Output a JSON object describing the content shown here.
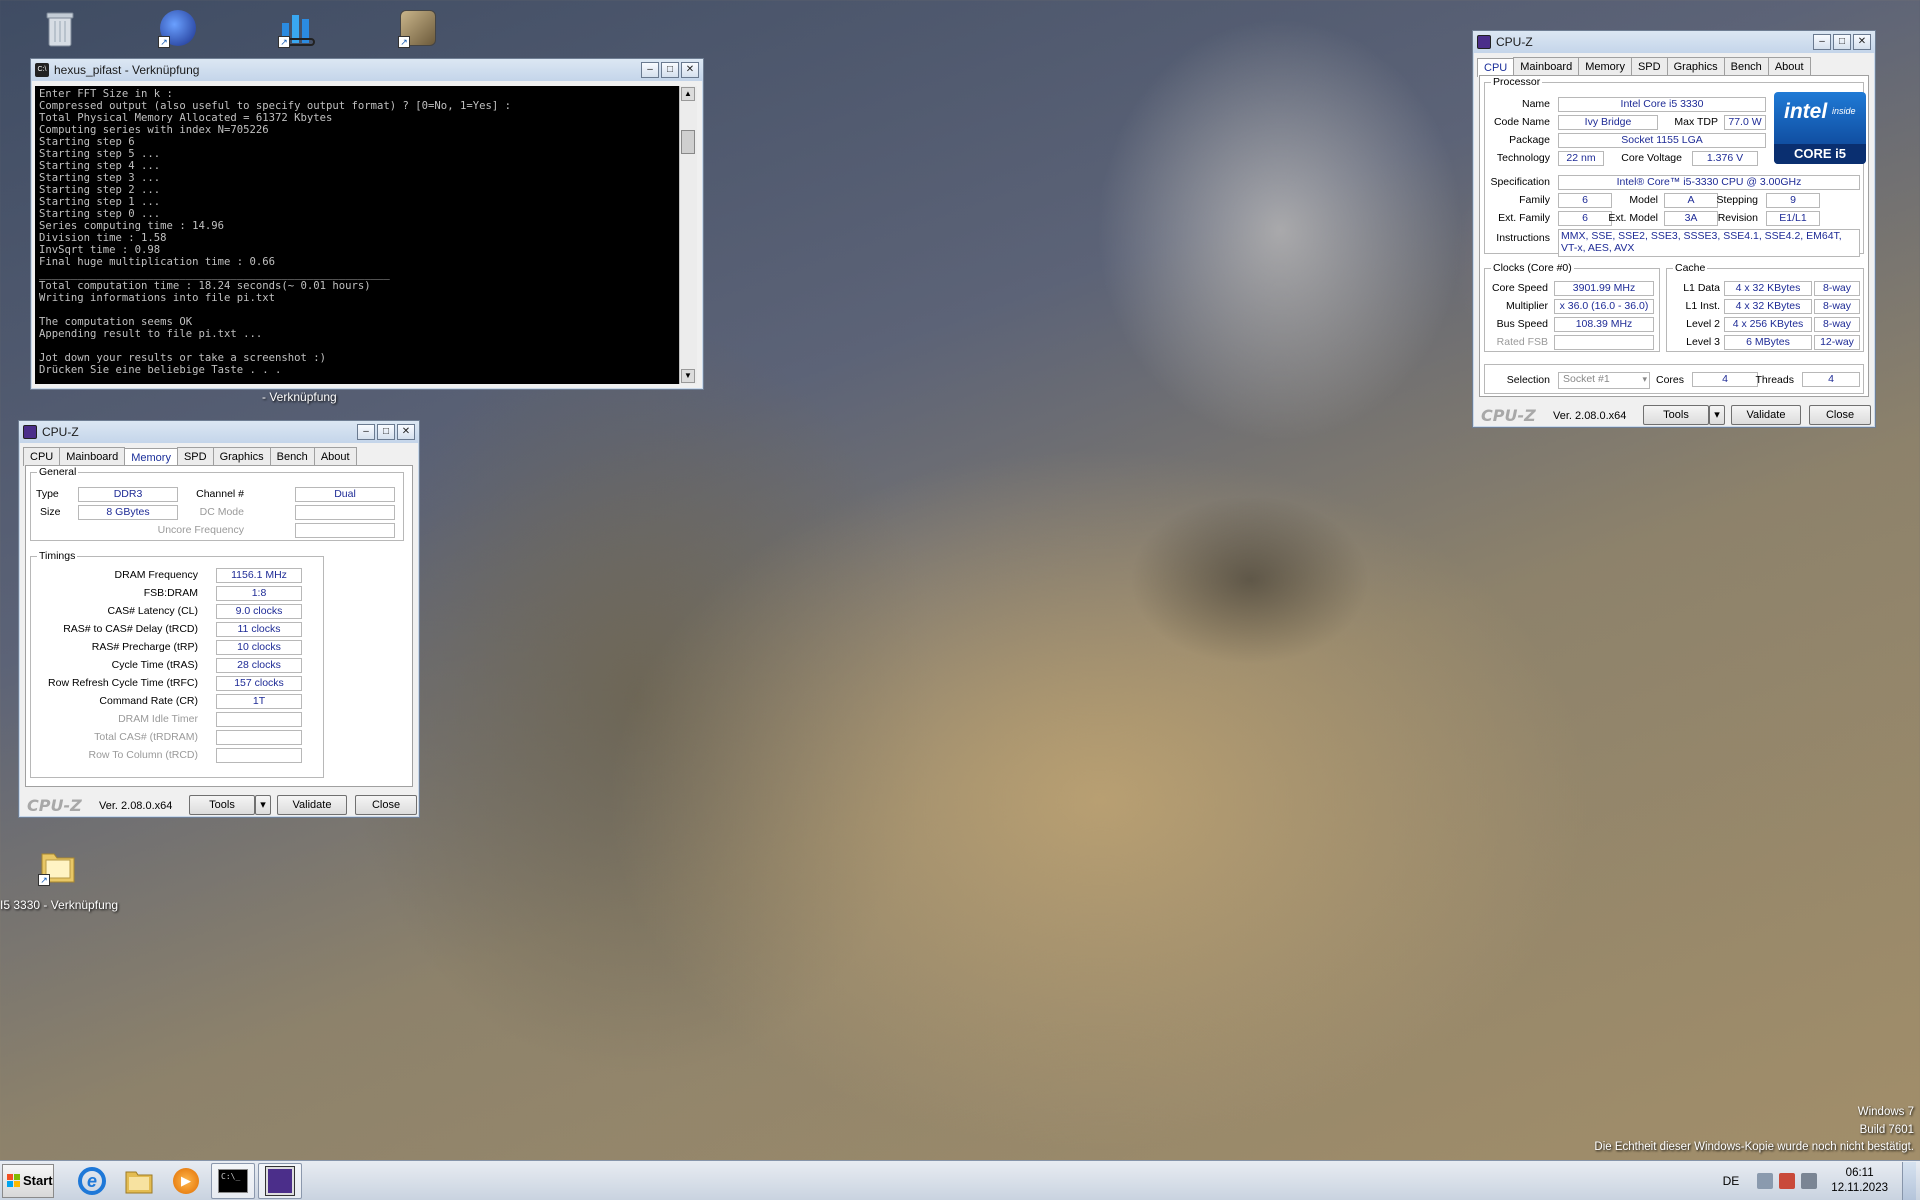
{
  "desktop": {
    "shortcut_label": "I5 3330 - Verknüpfung",
    "partial_label": "- Verknüpfung"
  },
  "console": {
    "title": "hexus_pifast - Verknüpfung",
    "lines": [
      "Enter FFT Size in k :",
      "Compressed output (also useful to specify output format) ? [0=No, 1=Yes] :",
      "Total Physical Memory Allocated = 61372 Kbytes",
      "Computing series with index N=705226",
      "Starting step 6",
      "Starting step 5 ...",
      "Starting step 4 ...",
      "Starting step 3 ...",
      "Starting step 2 ...",
      "Starting step 1 ...",
      "Starting step 0 ...",
      "Series computing time : 14.96",
      "Division time : 1.58",
      "InvSqrt time : 0.98",
      "Final huge multiplication time : 0.66",
      "_______________________________________________________",
      "Total computation time : 18.24 seconds(~ 0.01 hours)",
      "Writing informations into file pi.txt",
      "",
      "The computation seems OK",
      "Appending result to file pi.txt ...",
      "",
      "Jot down your results or take a screenshot :)",
      "Drücken Sie eine beliebige Taste . . ."
    ]
  },
  "common": {
    "app_title": "CPU-Z",
    "tabs": [
      "CPU",
      "Mainboard",
      "Memory",
      "SPD",
      "Graphics",
      "Bench",
      "About"
    ],
    "logo": "CPU-Z",
    "version": "Ver. 2.08.0.x64",
    "tools": "Tools",
    "validate": "Validate",
    "close": "Close"
  },
  "cpu": {
    "processor_legend": "Processor",
    "name_label": "Name",
    "name": "Intel Core i5 3330",
    "codename_label": "Code Name",
    "codename": "Ivy Bridge",
    "maxtdp_label": "Max TDP",
    "maxtdp": "77.0 W",
    "package_label": "Package",
    "package": "Socket 1155 LGA",
    "technology_label": "Technology",
    "technology": "22 nm",
    "corevoltage_label": "Core Voltage",
    "corevoltage": "1.376 V",
    "spec_label": "Specification",
    "spec": "Intel® Core™ i5-3330 CPU @ 3.00GHz",
    "family_label": "Family",
    "family": "6",
    "model_label": "Model",
    "model": "A",
    "stepping_label": "Stepping",
    "stepping": "9",
    "extfamily_label": "Ext. Family",
    "extfamily": "6",
    "extmodel_label": "Ext. Model",
    "extmodel": "3A",
    "revision_label": "Revision",
    "revision": "E1/L1",
    "instructions_label": "Instructions",
    "instructions": "MMX, SSE, SSE2, SSE3, SSSE3, SSE4.1, SSE4.2, EM64T, VT-x, AES, AVX",
    "clocks_legend": "Clocks (Core #0)",
    "corespeed_label": "Core Speed",
    "corespeed": "3901.99 MHz",
    "multiplier_label": "Multiplier",
    "multiplier": "x 36.0 (16.0 - 36.0)",
    "busspeed_label": "Bus Speed",
    "busspeed": "108.39 MHz",
    "ratedfsb_label": "Rated FSB",
    "cache_legend": "Cache",
    "l1d_label": "L1 Data",
    "l1d": "4 x 32 KBytes",
    "l1d_way": "8-way",
    "l1i_label": "L1 Inst.",
    "l1i": "4 x 32 KBytes",
    "l1i_way": "8-way",
    "l2_label": "Level 2",
    "l2": "4 x 256 KBytes",
    "l2_way": "8-way",
    "l3_label": "Level 3",
    "l3": "6 MBytes",
    "l3_way": "12-way",
    "selection_label": "Selection",
    "selection": "Socket #1",
    "cores_label": "Cores",
    "cores": "4",
    "threads_label": "Threads",
    "threads": "4",
    "intel_top": "intel",
    "intel_inside": "inside",
    "intel_bottom": "CORE i5"
  },
  "memory": {
    "general_legend": "General",
    "type_label": "Type",
    "type": "DDR3",
    "size_label": "Size",
    "size": "8 GBytes",
    "channel_label": "Channel #",
    "channel": "Dual",
    "dcmode_label": "DC Mode",
    "uncore_label": "Uncore Frequency",
    "timings_legend": "Timings",
    "timings": [
      {
        "label": "DRAM Frequency",
        "value": "1156.1 MHz",
        "dim": false
      },
      {
        "label": "FSB:DRAM",
        "value": "1:8",
        "dim": false
      },
      {
        "label": "CAS# Latency (CL)",
        "value": "9.0 clocks",
        "dim": false
      },
      {
        "label": "RAS# to CAS# Delay (tRCD)",
        "value": "11 clocks",
        "dim": false
      },
      {
        "label": "RAS# Precharge (tRP)",
        "value": "10 clocks",
        "dim": false
      },
      {
        "label": "Cycle Time (tRAS)",
        "value": "28 clocks",
        "dim": false
      },
      {
        "label": "Row Refresh Cycle Time (tRFC)",
        "value": "157 clocks",
        "dim": false
      },
      {
        "label": "Command Rate (CR)",
        "value": "1T",
        "dim": false
      },
      {
        "label": "DRAM Idle Timer",
        "value": "",
        "dim": true
      },
      {
        "label": "Total CAS# (tRDRAM)",
        "value": "",
        "dim": true
      },
      {
        "label": "Row To Column (tRCD)",
        "value": "",
        "dim": true
      }
    ]
  },
  "watermark": {
    "line1": "Windows 7",
    "line2": "Build 7601",
    "line3": "Die Echtheit dieser Windows-Kopie wurde noch nicht bestätigt."
  },
  "taskbar": {
    "start": "Start",
    "lang": "DE",
    "time": "06:11",
    "date": "12.11.2023"
  }
}
